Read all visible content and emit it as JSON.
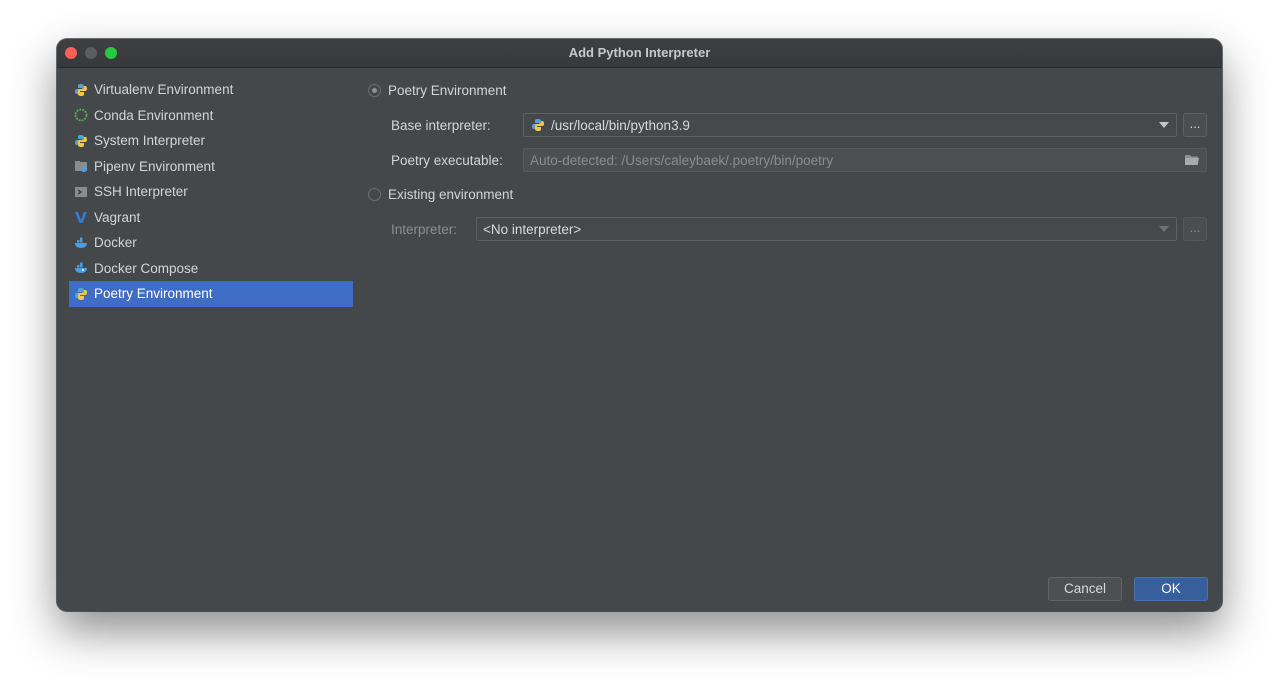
{
  "window": {
    "title": "Add Python Interpreter"
  },
  "sidebar": {
    "items": [
      {
        "label": "Virtualenv Environment",
        "icon": "python-virtualenv-icon",
        "selected": false
      },
      {
        "label": "Conda Environment",
        "icon": "conda-ring-icon",
        "selected": false
      },
      {
        "label": "System Interpreter",
        "icon": "python-icon",
        "selected": false
      },
      {
        "label": "Pipenv Environment",
        "icon": "pipenv-icon",
        "selected": false
      },
      {
        "label": "SSH Interpreter",
        "icon": "terminal-icon",
        "selected": false
      },
      {
        "label": "Vagrant",
        "icon": "vagrant-v-icon",
        "selected": false
      },
      {
        "label": "Docker",
        "icon": "docker-whale-icon",
        "selected": false
      },
      {
        "label": "Docker Compose",
        "icon": "docker-compose-icon",
        "selected": false
      },
      {
        "label": "Poetry Environment",
        "icon": "poetry-icon",
        "selected": true
      }
    ]
  },
  "main": {
    "poetry_radio_label": "Poetry Environment",
    "base_interpreter_label": "Base interpreter:",
    "base_interpreter_value": "/usr/local/bin/python3.9",
    "poetry_executable_label": "Poetry executable:",
    "poetry_executable_placeholder": "Auto-detected: /Users/caleybaek/.poetry/bin/poetry",
    "existing_radio_label": "Existing environment",
    "interpreter_label": "Interpreter:",
    "interpreter_value": "<No interpreter>",
    "browse_label": "..."
  },
  "buttons": {
    "cancel": "Cancel",
    "ok": "OK"
  },
  "colors": {
    "selection": "#3f6dc6",
    "ok_button": "#365f9c",
    "background": "#45484b"
  }
}
